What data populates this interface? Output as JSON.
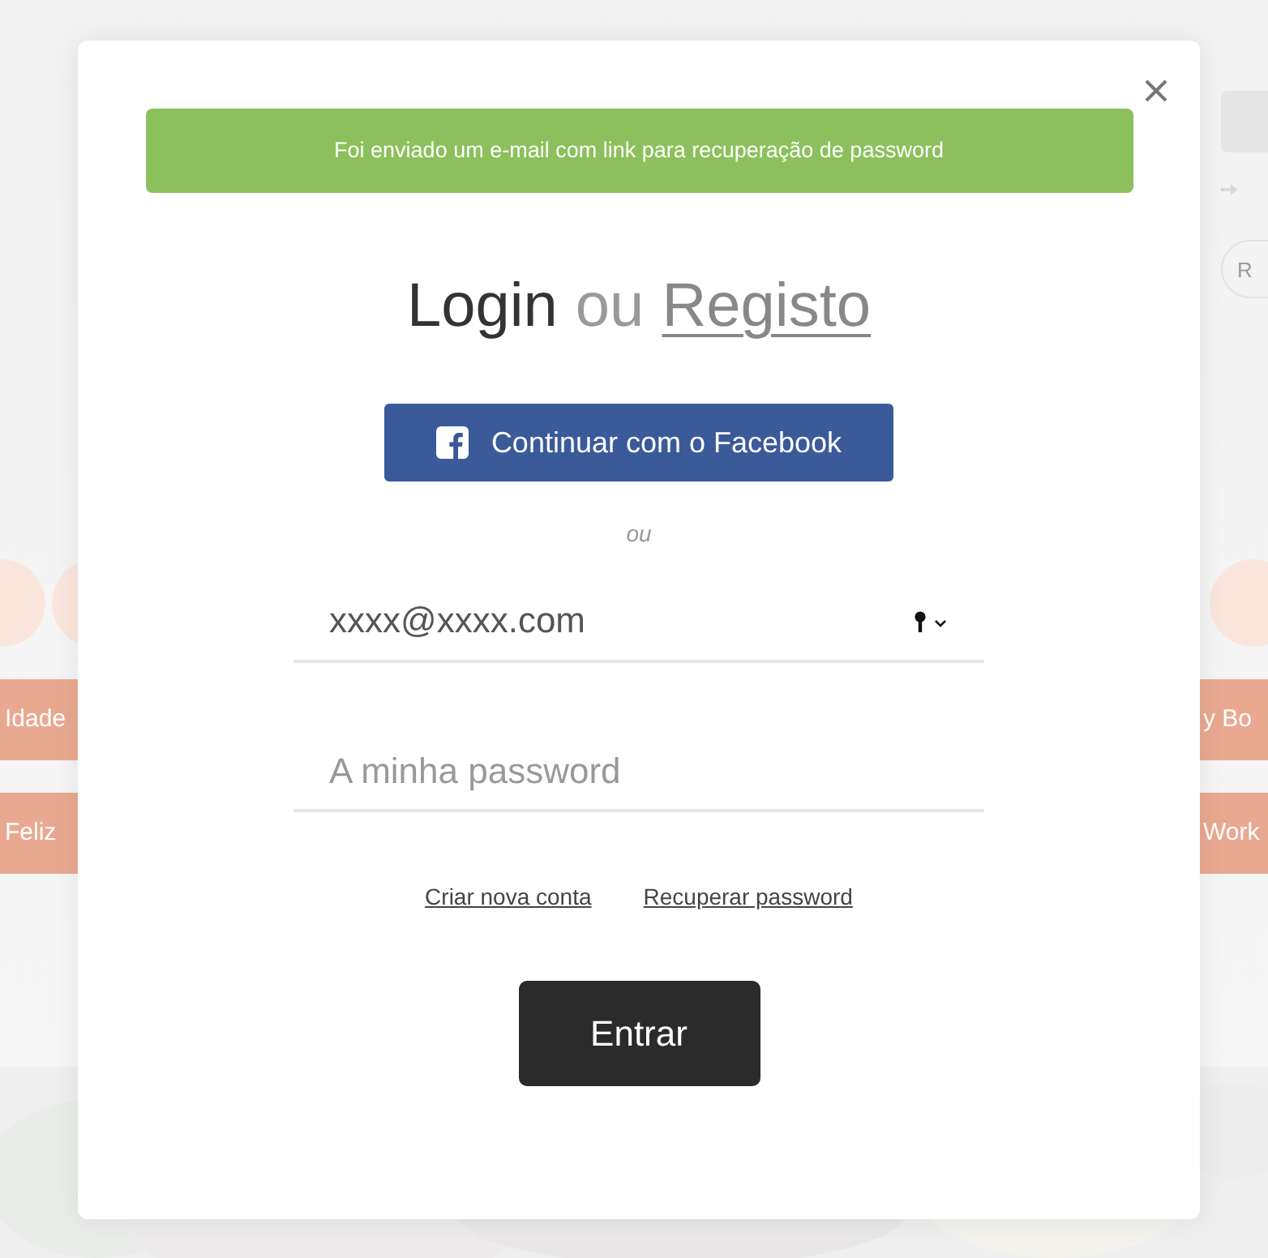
{
  "background": {
    "left_tags": [
      "Idade",
      "Feliz"
    ],
    "right_tags": [
      "y Bo",
      "Work"
    ],
    "filter_pill": "R"
  },
  "modal": {
    "alert": {
      "kind": "success",
      "text": "Foi enviado um e-mail com link para recuperação de password"
    },
    "title": {
      "login": "Login",
      "separator": "ou",
      "register": "Registo"
    },
    "facebook_button": "Continuar com o Facebook",
    "divider": "ou",
    "email": {
      "value": "xxxx@xxxx.com"
    },
    "password": {
      "placeholder": "A minha password"
    },
    "links": [
      "Criar nova conta",
      "Recuperar password"
    ],
    "submit": "Entrar"
  }
}
